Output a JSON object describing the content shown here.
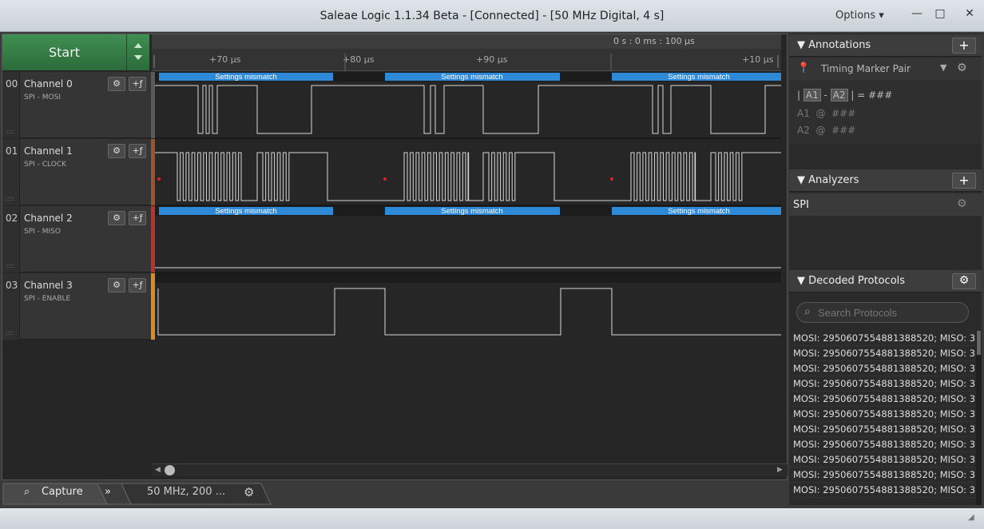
{
  "window": {
    "title": "Saleae Logic 1.1.34 Beta - [Connected] - [50 MHz Digital, 4 s]",
    "options_label": "Options ▾",
    "minimize": "—",
    "maximize": "□",
    "close": "✕"
  },
  "toolbar": {
    "start_label": "Start"
  },
  "ruler": {
    "time_label": "0 s : 0 ms : 100 µs",
    "ticks": [
      "+70 µs",
      "+80 µs",
      "+90 µs",
      "+10 µs"
    ]
  },
  "channels": [
    {
      "num": "00",
      "name": "Channel 0",
      "sub": "SPI - MOSI",
      "color": "#5a5a5a"
    },
    {
      "num": "01",
      "name": "Channel 1",
      "sub": "SPI - CLOCK",
      "color": "#a0522d"
    },
    {
      "num": "02",
      "name": "Channel 2",
      "sub": "SPI - MISO",
      "color": "#c0302a"
    },
    {
      "num": "03",
      "name": "Channel 3",
      "sub": "SPI - ENABLE",
      "color": "#e08a1e"
    }
  ],
  "channel_buttons": {
    "gear": "⚙",
    "trigger": "+ƒ"
  },
  "annotation_bubble": "Settings mismatch",
  "bottom": {
    "capture_label": "Capture",
    "chevrons": "»",
    "rate_label": "50 MHz, 200 ...",
    "gear": "⚙"
  },
  "annotations": {
    "header": "Annotations",
    "plus": "+",
    "marker_label": "Timing Marker Pair",
    "marker_icon": "pin-icon",
    "eq_a1": "A1",
    "eq_dash": "-",
    "eq_a2": "A2",
    "eq_result": "= ###",
    "a1_label": "A1",
    "a1_at": "@",
    "a1_val": "###",
    "a2_label": "A2",
    "a2_at": "@",
    "a2_val": "###"
  },
  "analyzers": {
    "header": "Analyzers",
    "plus": "+",
    "items": [
      "SPI"
    ]
  },
  "decoded": {
    "header": "Decoded Protocols",
    "search_placeholder": "Search Protocols",
    "rows": [
      "MOSI: 2950607554881388520;  MISO: 3...",
      "MOSI: 2950607554881388520;  MISO: 3...",
      "MOSI: 2950607554881388520;  MISO: 3...",
      "MOSI: 2950607554881388520;  MISO: 3...",
      "MOSI: 2950607554881388520;  MISO: 3...",
      "MOSI: 2950607554881388520;  MISO: 3...",
      "MOSI: 2950607554881388520;  MISO: 3...",
      "MOSI: 2950607554881388520;  MISO: 3...",
      "MOSI: 2950607554881388520;  MISO: 3...",
      "MOSI: 2950607554881388520;  MISO: 3...",
      "MOSI: 2950607554881388520;  MISO: 3..."
    ]
  },
  "colors": {
    "accent_blue": "#2e8ad8",
    "start_green": "#357d46"
  }
}
